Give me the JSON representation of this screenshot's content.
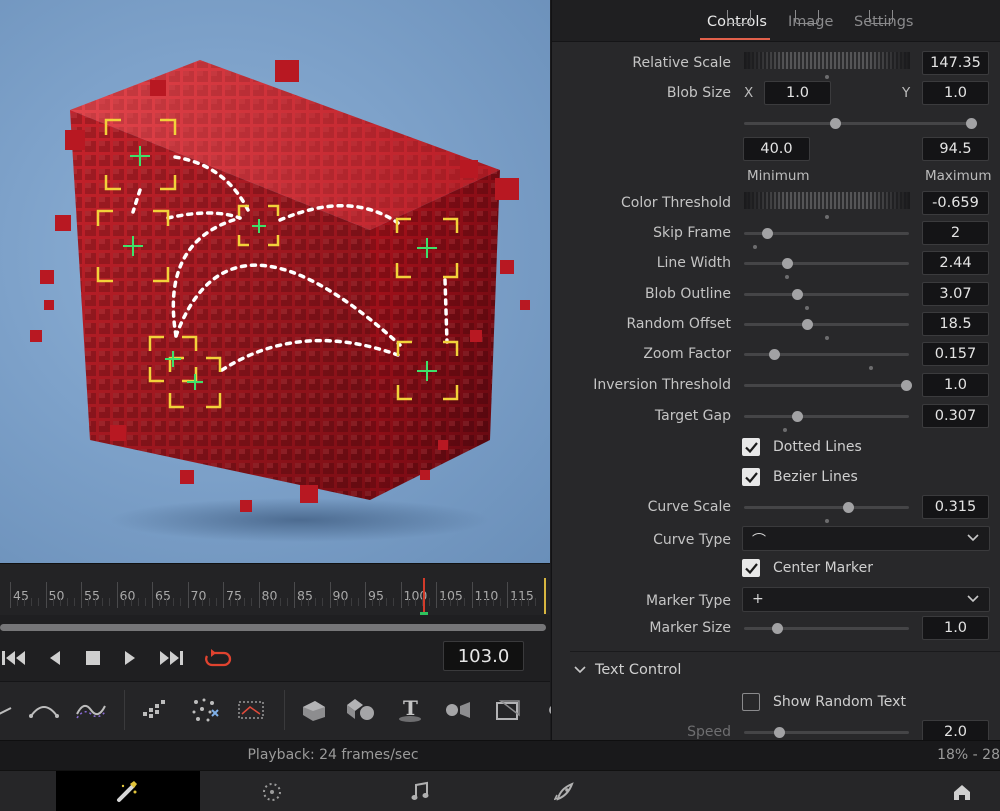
{
  "inspector": {
    "tabs": [
      {
        "label": "Controls",
        "active": true
      },
      {
        "label": "Image",
        "active": false
      },
      {
        "label": "Settings",
        "active": false
      }
    ],
    "relative_scale": {
      "label": "Relative Scale",
      "value": "147.35"
    },
    "blob_size": {
      "label": "Blob Size",
      "x_label": "X",
      "x_value": "1.0",
      "y_label": "Y",
      "y_value": "1.0",
      "min_value": "40.0",
      "max_value": "94.5",
      "min_label": "Minimum",
      "max_label": "Maximum"
    },
    "color_threshold": {
      "label": "Color Threshold",
      "value": "-0.659"
    },
    "sliders": [
      {
        "label": "Skip Frame",
        "value": "2",
        "level": 0.14
      },
      {
        "label": "Line Width",
        "value": "2.44",
        "level": 0.26
      },
      {
        "label": "Blob Outline",
        "value": "3.07",
        "level": 0.32
      },
      {
        "label": "Random Offset",
        "value": "18.5",
        "level": 0.38
      },
      {
        "label": "Zoom Factor",
        "value": "0.157",
        "level": 0.18
      },
      {
        "label": "Inversion Threshold",
        "value": "1.0",
        "level": 0.98
      },
      {
        "label": "Target Gap",
        "value": "0.307",
        "level": 0.32
      }
    ],
    "dotted_lines": {
      "label": "Dotted Lines",
      "checked": true
    },
    "bezier_lines": {
      "label": "Bezier Lines",
      "checked": true
    },
    "curve_scale": {
      "label": "Curve Scale",
      "value": "0.315",
      "level": 0.63
    },
    "curve_type": {
      "label": "Curve Type",
      "value": "⌒"
    },
    "center_marker": {
      "label": "Center Marker",
      "checked": true
    },
    "marker_type": {
      "label": "Marker Type",
      "value": "+"
    },
    "marker_size": {
      "label": "Marker Size",
      "value": "1.0",
      "level": 0.2
    },
    "text_control": {
      "label": "Text Control",
      "expanded": true
    },
    "show_random_text": {
      "label": "Show Random Text",
      "checked": false
    },
    "speed": {
      "label": "Speed",
      "value": "2.0",
      "level": 0.21
    }
  },
  "timeline": {
    "ticks": [
      "45",
      "50",
      "55",
      "60",
      "65",
      "70",
      "75",
      "80",
      "85",
      "90",
      "95",
      "100",
      "105",
      "110",
      "115"
    ],
    "current_frame": "103.0"
  },
  "status": {
    "playback": "Playback: 24 frames/sec",
    "zoom": "18% - 28"
  },
  "colors": {
    "accent": "#e1604b",
    "tracker_box": "#f2d23a",
    "tracker_cross": "#3fe06a",
    "playhead": "#d23b2a"
  },
  "icons": {
    "transport": [
      "skip-to-start-icon",
      "step-back-icon",
      "stop-icon",
      "play-icon",
      "skip-to-end-icon",
      "loop-icon"
    ],
    "pages": [
      "fusion-page-icon",
      "color-page-icon",
      "fairlight-page-icon",
      "deliver-page-icon",
      "home-icon"
    ]
  }
}
